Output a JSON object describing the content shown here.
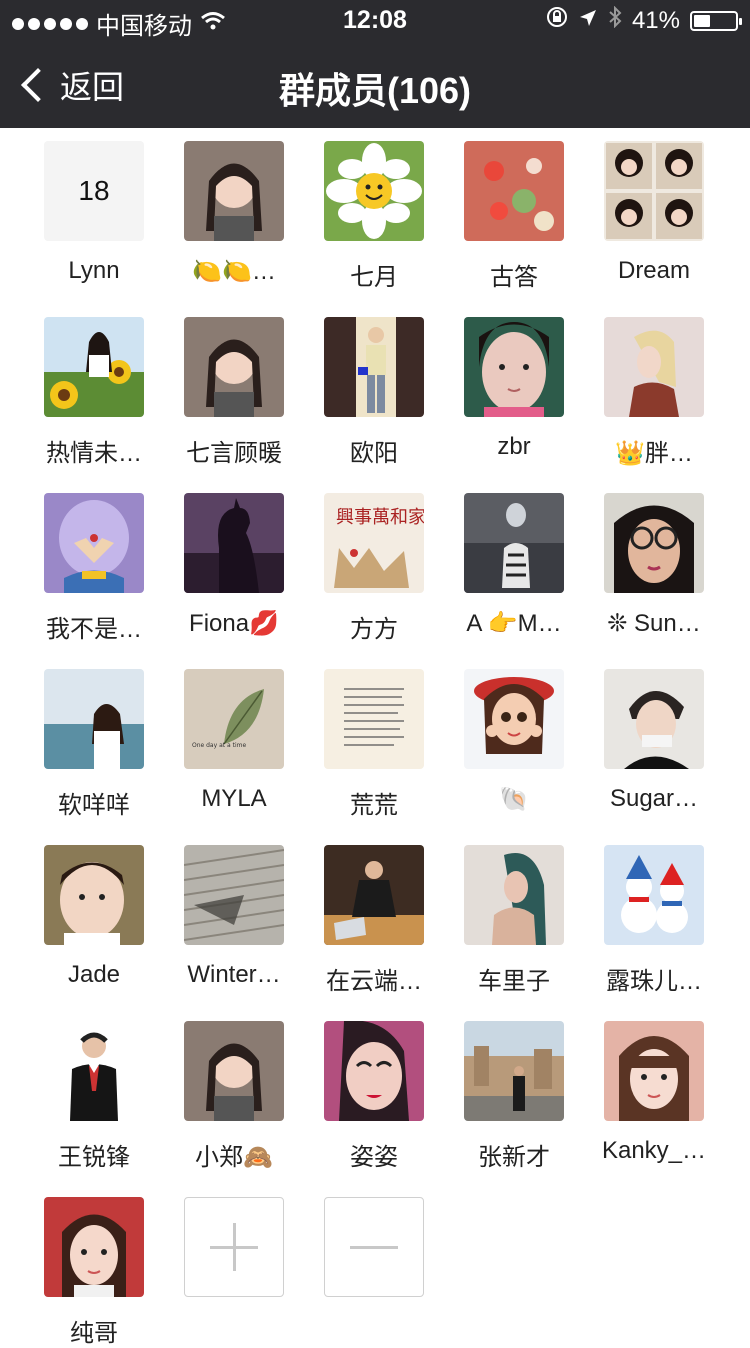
{
  "status": {
    "carrier": "中国移动",
    "time": "12:08",
    "battery": "41%",
    "battery_level": 0.41
  },
  "nav": {
    "back_label": "返回",
    "title": "群成员(106)"
  },
  "members": [
    {
      "name": "Lynn",
      "avatar_text": "18",
      "avatar_icon": "number-tile"
    },
    {
      "name": "🍋🍋…",
      "avatar_icon": "girl-photo"
    },
    {
      "name": "七月",
      "avatar_icon": "smiling-flower"
    },
    {
      "name": "古答",
      "avatar_icon": "red-berries"
    },
    {
      "name": "Dream",
      "avatar_icon": "girl-collage"
    },
    {
      "name": "热情未…",
      "avatar_icon": "sunflower-girl"
    },
    {
      "name": "七言顾暖",
      "avatar_icon": "girl-photo"
    },
    {
      "name": "欧阳",
      "avatar_icon": "person-standing"
    },
    {
      "name": "zbr",
      "avatar_icon": "girl-face"
    },
    {
      "name": "👑胖…",
      "avatar_icon": "illustrated-girl"
    },
    {
      "name": "我不是…",
      "avatar_icon": "cartoon-character"
    },
    {
      "name": "Fiona💋",
      "avatar_icon": "silhouette"
    },
    {
      "name": "方方",
      "avatar_icon": "calligraphy"
    },
    {
      "name": "A 👉M…",
      "avatar_icon": "cat-tiger-reflection"
    },
    {
      "name": "❊ Sun…",
      "avatar_icon": "girl-glasses"
    },
    {
      "name": "软咩咩",
      "avatar_icon": "beach-girl"
    },
    {
      "name": "MYLA",
      "avatar_icon": "leaf"
    },
    {
      "name": "荒荒",
      "avatar_icon": "text-note"
    },
    {
      "name": "🐚",
      "avatar_icon": "cartoon-girl-hat"
    },
    {
      "name": "Sugar…",
      "avatar_icon": "boy-photo"
    },
    {
      "name": "Jade",
      "avatar_icon": "child-photo"
    },
    {
      "name": "Winter…",
      "avatar_icon": "boardwalk"
    },
    {
      "name": "在云端…",
      "avatar_icon": "man-laptop"
    },
    {
      "name": "车里子",
      "avatar_icon": "girl-profile"
    },
    {
      "name": "露珠儿…",
      "avatar_icon": "snowmen"
    },
    {
      "name": "王锐锋",
      "avatar_icon": "businessman"
    },
    {
      "name": "小郑🙈",
      "avatar_icon": "girl-photo"
    },
    {
      "name": "姿姿",
      "avatar_icon": "makeup-face"
    },
    {
      "name": "张新才",
      "avatar_icon": "ruins-man"
    },
    {
      "name": "Kanky_…",
      "avatar_icon": "girl-bangs"
    },
    {
      "name": "纯哥",
      "avatar_icon": "girl-red"
    }
  ],
  "actions": {
    "add_icon": "plus-icon",
    "remove_icon": "minus-icon"
  },
  "colors": {
    "nav_bg": "#2b2b2f",
    "nav_text": "#ffffff",
    "name_text": "#222222",
    "action_border": "#d0d0d0"
  }
}
